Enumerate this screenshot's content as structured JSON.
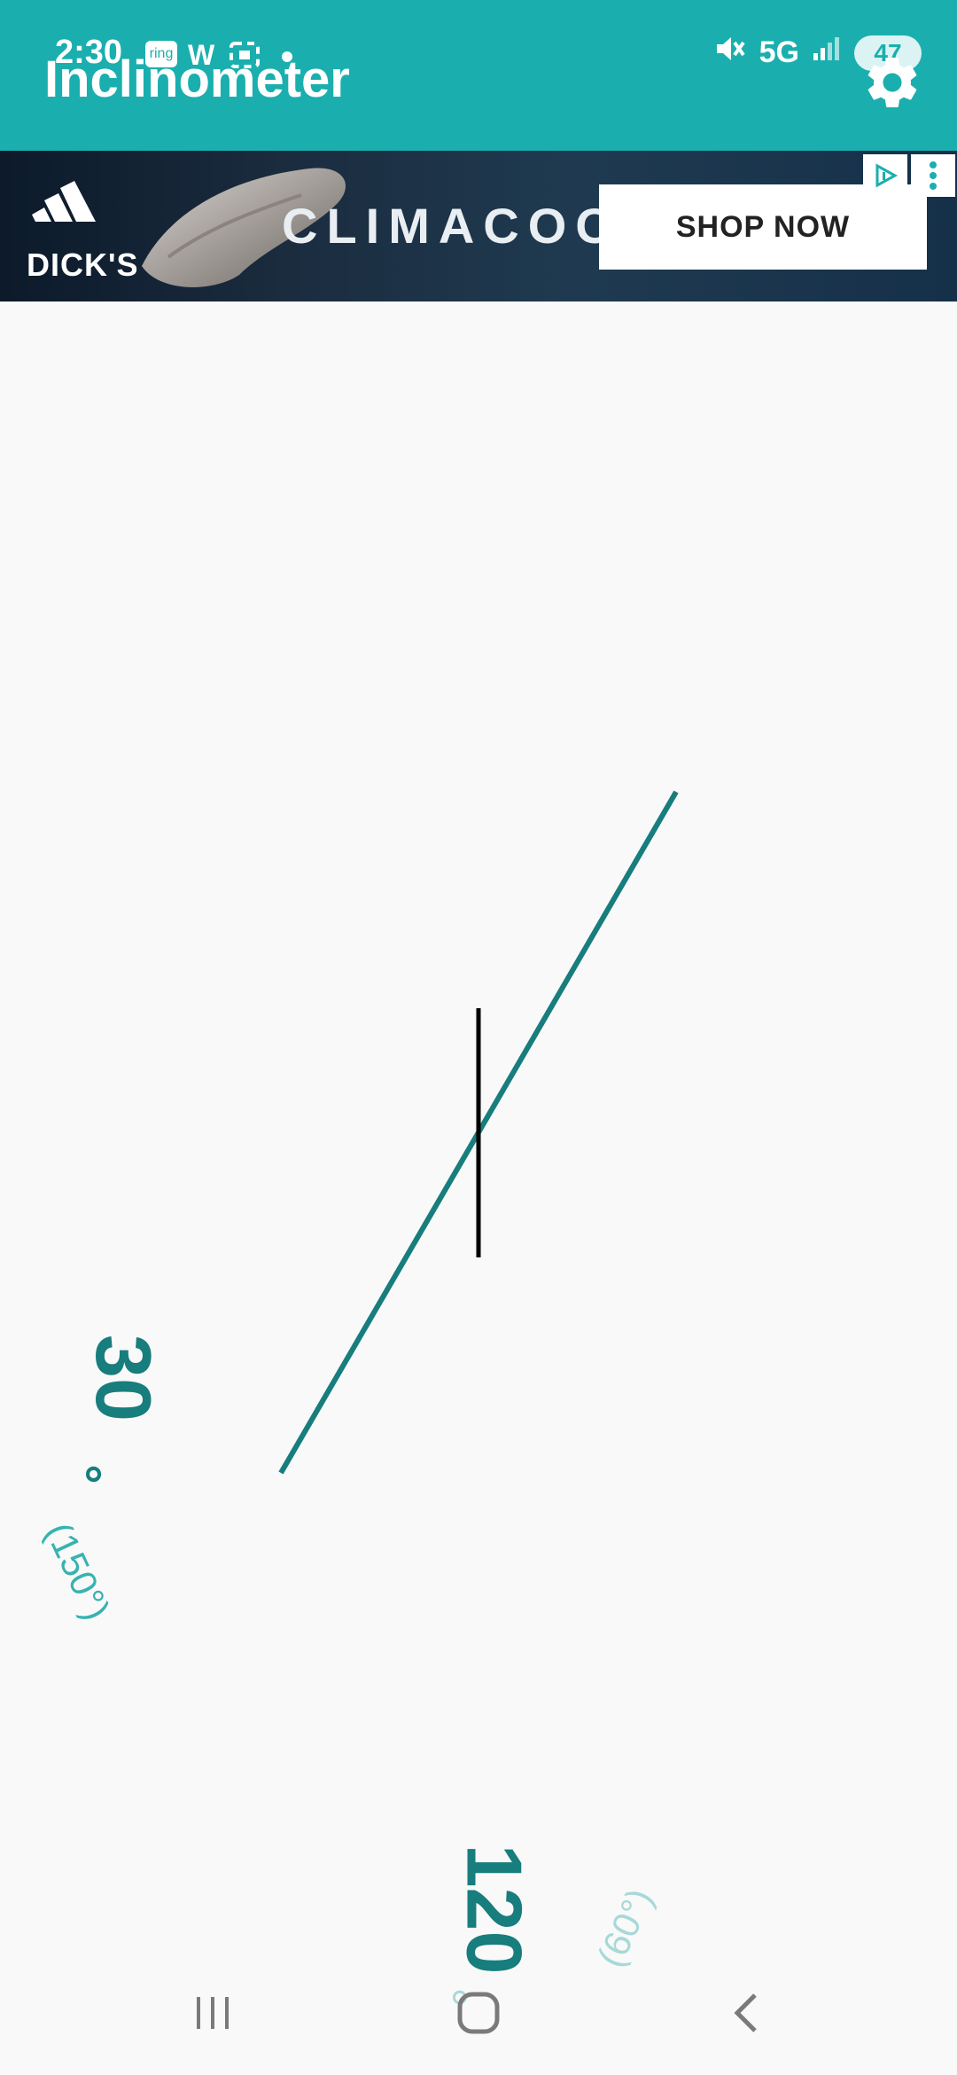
{
  "status_bar": {
    "time": "2:30",
    "notification_icons": [
      "ring-icon",
      "w-icon",
      "screenshot-icon",
      "dot-icon"
    ],
    "ring_label": "ring",
    "w_label": "W",
    "network": "5G",
    "battery": "47"
  },
  "app_bar": {
    "title": "Inclinometer",
    "settings_icon": "gear-icon"
  },
  "ad": {
    "brand": "DICK'S",
    "product": "CLIMACOOL",
    "cta": "SHOP NOW"
  },
  "gauge": {
    "angle_primary": "30",
    "angle_degree_symbol": "°",
    "angle_secondary": "(150°)",
    "angle_bottom": "120",
    "angle_bottom_degree": "°",
    "angle_bottom_secondary": "(60°)",
    "colors": {
      "teal_dark": "#177d7d",
      "teal_mid": "#36b3b1",
      "teal_light": "#a7d9d8",
      "reference_line": "#000000"
    }
  },
  "nav_bar": {
    "recent_icon": "recent-apps-icon",
    "home_icon": "home-icon",
    "back_icon": "back-icon"
  }
}
